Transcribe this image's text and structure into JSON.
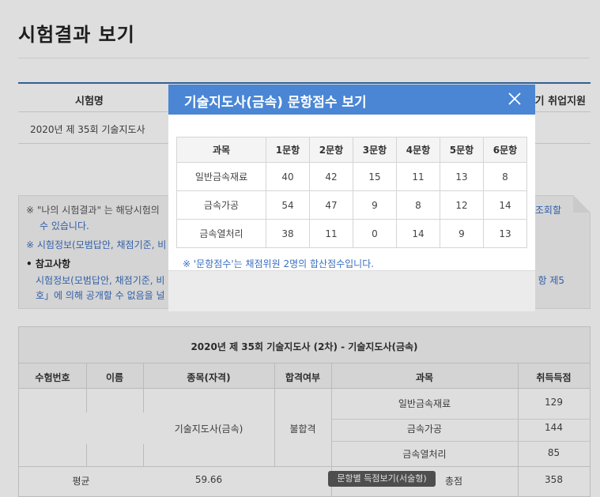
{
  "page": {
    "title": "시험결과 보기"
  },
  "top_table": {
    "col_exam": "시험명",
    "col_right": "기 취업지원",
    "row1": "2020년 제 35회 기술지도사"
  },
  "notice": {
    "line1": "※ \"나의 시험결과\" 는 해당시험의",
    "line1_right": "조회할",
    "line1b": "수 있습니다.",
    "line2": "※ 시험정보(모범답안, 채점기준, 비",
    "line3": "참고사항",
    "line4": "시험정보(모범답안, 채점기준, 비",
    "line4_right": "항 제5",
    "line5": "호」에 의해 공개할 수 없음을 널"
  },
  "results": {
    "title": "2020년 제 35회 기술지도사 (2차) - 기술지도사(금속)",
    "headers": [
      "수험번호",
      "이름",
      "종목(자격)",
      "합격여부",
      "과목",
      "취득득점"
    ],
    "qualification": "기술지도사(금속)",
    "pass_status": "불합격",
    "subjects": [
      {
        "name": "일반금속재료",
        "score": "129"
      },
      {
        "name": "금속가공",
        "score": "144"
      },
      {
        "name": "금속열처리",
        "score": "85"
      }
    ],
    "avg_label": "평균",
    "avg_value": "59.66",
    "detail_button": "문항별 득점보기(서술형)",
    "total_label": "총점",
    "total_value": "358"
  },
  "modal": {
    "title": "기술지도사(금속) 문항점수 보기",
    "close_icon": "close-icon",
    "headers": [
      "과목",
      "1문항",
      "2문항",
      "3문항",
      "4문항",
      "5문항",
      "6문항"
    ],
    "rows": [
      {
        "subject": "일반금속재료",
        "scores": [
          "40",
          "42",
          "15",
          "11",
          "13",
          "8"
        ]
      },
      {
        "subject": "금속가공",
        "scores": [
          "54",
          "47",
          "9",
          "8",
          "12",
          "14"
        ]
      },
      {
        "subject": "금속열처리",
        "scores": [
          "38",
          "11",
          "0",
          "14",
          "9",
          "13"
        ]
      }
    ],
    "note": "※ '문항점수'는 채점위원 2명의 합산점수입니다."
  },
  "colors": {
    "accent": "#4a86d4",
    "link": "#3a6fc2"
  }
}
